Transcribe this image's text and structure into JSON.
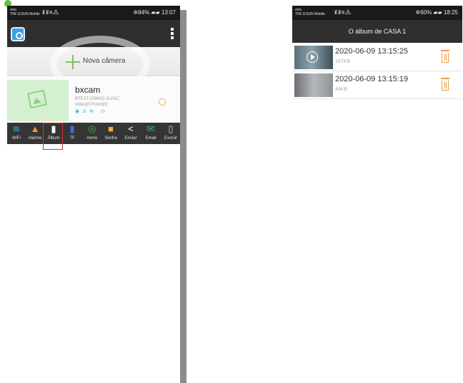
{
  "left_phone": {
    "status": {
      "carrier": "vivo\nTIM 11SUN Mobile",
      "signal": "⫶ıl ⫶ıl ≋ ⚠",
      "battery": "✲84% ▰▰ 13:07"
    },
    "new_camera_label": "Nova câmera",
    "camera": {
      "name": "bxcam",
      "id": "BTEST-039632-JLVGC",
      "counts": "Video[0] Fotos[0]",
      "icons": "◉ ♙ ≋",
      "icons_extra": "⊟"
    },
    "toolbar": [
      {
        "label": "WiFi",
        "icon": "wifi-icon",
        "glyph": "📶",
        "color": "#36a8e0"
      },
      {
        "label": "Alarme",
        "icon": "bell-icon",
        "glyph": "🔔",
        "color": "#f39a2b"
      },
      {
        "label": "Álbum",
        "icon": "album-icon",
        "glyph": "▮",
        "color": "#ffffff"
      },
      {
        "label": "TF",
        "icon": "sd-card-icon",
        "glyph": "▮",
        "color": "#3b6fd8"
      },
      {
        "label": "nome",
        "icon": "rename-icon",
        "glyph": "⊘",
        "color": "#4caf50"
      },
      {
        "label": "Senha",
        "icon": "lock-icon",
        "glyph": "🔒",
        "color": "#f2b33a"
      },
      {
        "label": "Enviar",
        "icon": "share-icon",
        "glyph": "<",
        "color": "#ffffff"
      },
      {
        "label": "Email",
        "icon": "email-icon",
        "glyph": "✉",
        "color": "#3cb371"
      },
      {
        "label": "Excluir",
        "icon": "trash-icon",
        "glyph": "🗑",
        "color": "#cfcfcf"
      }
    ]
  },
  "right_phone": {
    "status": {
      "carrier": "vivo\nTIM 11SUN Mobile",
      "signal": "⫶ıl ⫶ıl ≋ ⚠",
      "battery": "✲60% ▰▰ 18:25"
    },
    "title": "O álbum de CASA 1",
    "videos": [
      {
        "date": "2020-06-09 13:15:25",
        "size": "167KB",
        "has_play": true
      },
      {
        "date": "2020-06-09 13:15:19",
        "size": "44KB",
        "has_play": false
      }
    ]
  }
}
